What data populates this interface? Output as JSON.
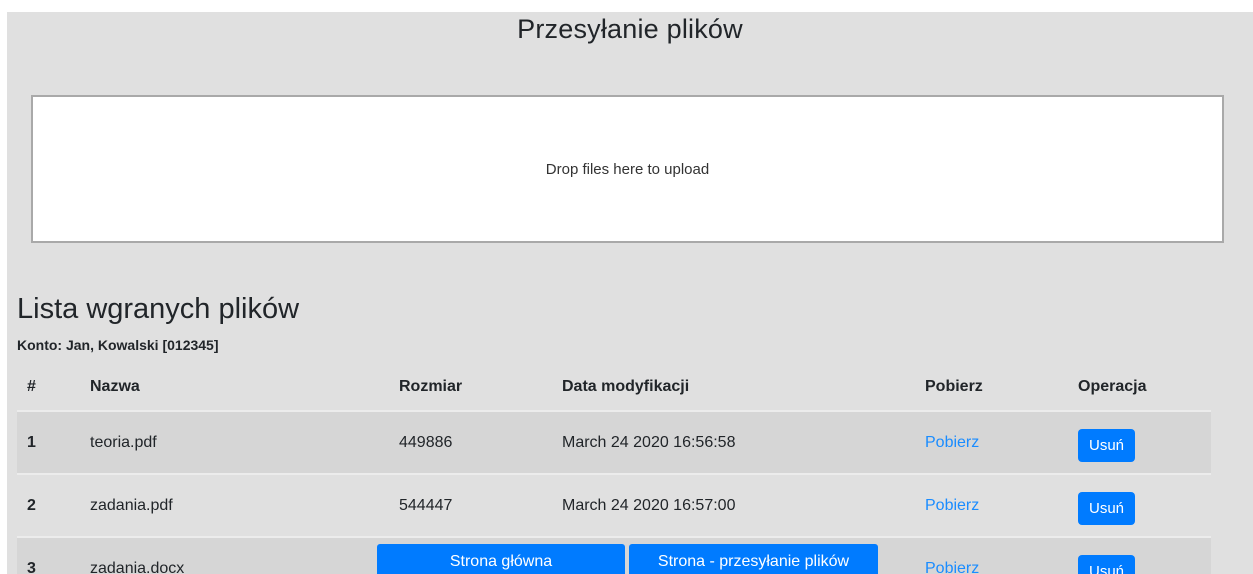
{
  "header": {
    "title": "Przesyłanie plików"
  },
  "dropzone": {
    "message": "Drop files here to upload"
  },
  "list": {
    "title": "Lista wgranych plików",
    "account": "Konto: Jan, Kowalski [012345]",
    "columns": {
      "num": "#",
      "name": "Nazwa",
      "size": "Rozmiar",
      "date": "Data modyfikacji",
      "download": "Pobierz",
      "operation": "Operacja"
    },
    "rows": [
      {
        "num": "1",
        "name": "teoria.pdf",
        "size": "449886",
        "date": "March 24 2020 16:56:58",
        "download": "Pobierz",
        "delete": "Usuń"
      },
      {
        "num": "2",
        "name": "zadania.pdf",
        "size": "544447",
        "date": "March 24 2020 16:57:00",
        "download": "Pobierz",
        "delete": "Usuń"
      },
      {
        "num": "3",
        "name": "zadania.docx",
        "download": "Pobierz",
        "delete": "Usuń"
      }
    ]
  },
  "nav": {
    "home": "Strona główna",
    "upload": "Strona - przesyłanie plików"
  },
  "colors": {
    "primary": "#007bff",
    "link": "#1a8cff",
    "page_bg": "#e0e0e0"
  }
}
